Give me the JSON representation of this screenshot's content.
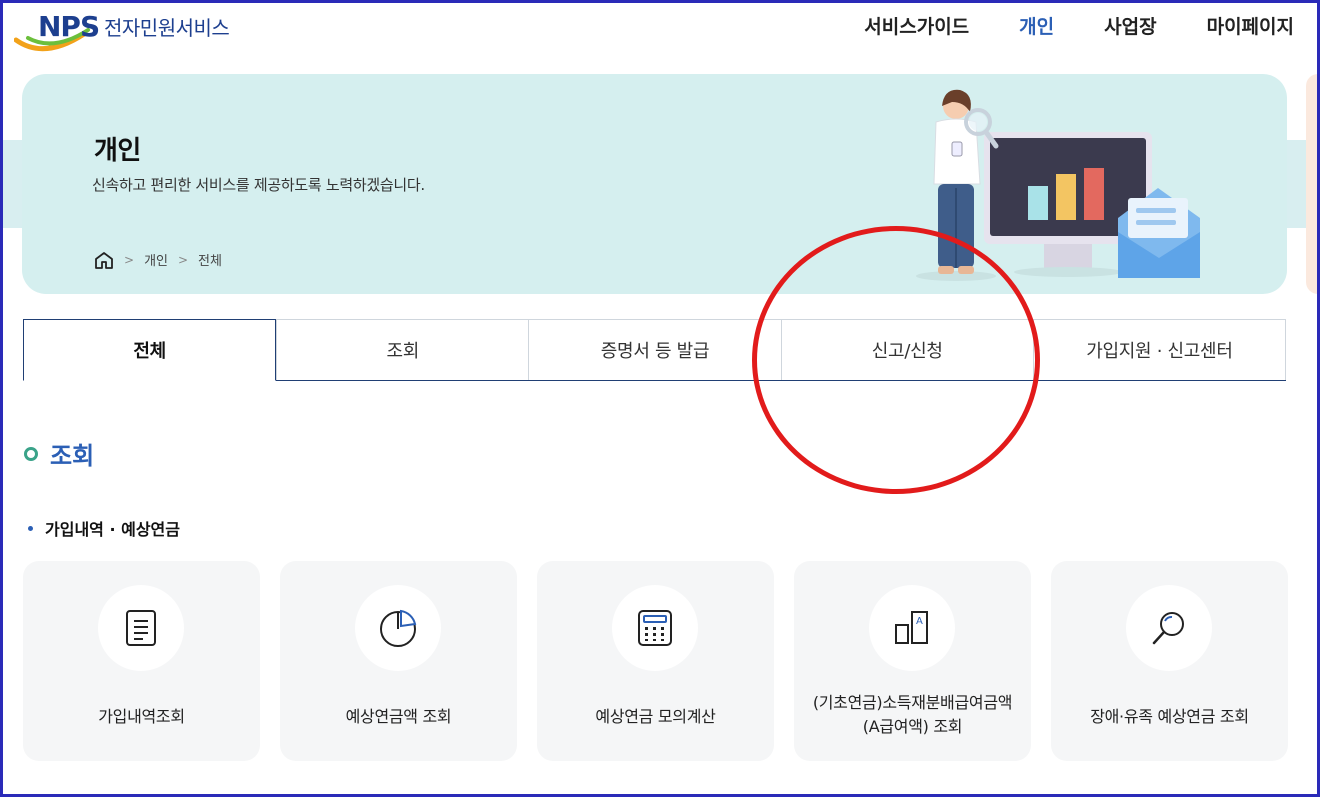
{
  "header": {
    "logo_text": "NPS",
    "logo_title": "전자민원서비스",
    "nav": [
      {
        "label": "서비스가이드",
        "active": false
      },
      {
        "label": "개인",
        "active": true
      },
      {
        "label": "사업장",
        "active": false
      },
      {
        "label": "마이페이지",
        "active": false
      }
    ]
  },
  "banner": {
    "title": "개인",
    "subtitle": "신속하고 편리한 서비스를 제공하도록 노력하겠습니다.",
    "breadcrumb": [
      "개인",
      "전체"
    ]
  },
  "tabs": [
    "전체",
    "조회",
    "증명서 등 발급",
    "신고/신청",
    "가입지원 · 신고센터"
  ],
  "section": {
    "title": "조회",
    "subtitle": "가입내역 · 예상연금",
    "cards": [
      {
        "label": "가입내역조회",
        "icon": "document-icon"
      },
      {
        "label": "예상연금액 조회",
        "icon": "pie-chart-icon"
      },
      {
        "label": "예상연금 모의계산",
        "icon": "calculator-icon"
      },
      {
        "label": "(기초연금)소득재분배급여금액(A급여액) 조회",
        "icon": "buildings-icon"
      },
      {
        "label": "장애·유족 예상연금 조회",
        "icon": "magnifier-icon"
      }
    ]
  },
  "colors": {
    "brand_blue": "#2b5fb5",
    "banner_bg": "#d5efef",
    "annotation_red": "#e21b1b"
  }
}
